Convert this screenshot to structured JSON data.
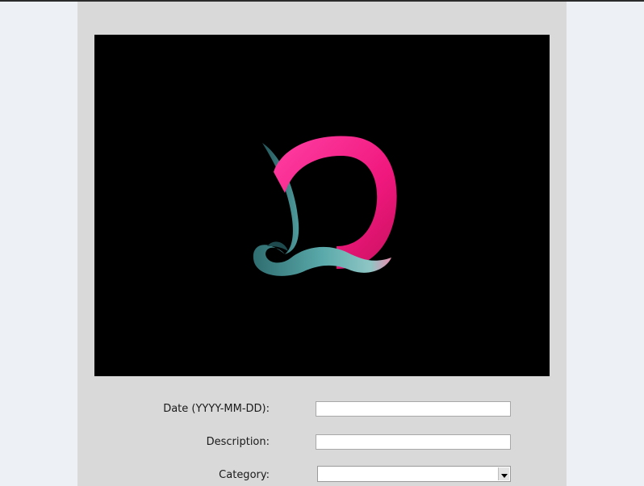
{
  "image": {
    "description_icon": "stylized-letter-d-logo-icon",
    "background": "#000000",
    "colors": {
      "pink": "#ff1f8e",
      "teal": "#4e9fa0"
    }
  },
  "form": {
    "date_label": "Date (YYYY-MM-DD):",
    "date_value": "",
    "description_label": "Description:",
    "description_value": "",
    "category_label": "Category:",
    "category_value": ""
  }
}
